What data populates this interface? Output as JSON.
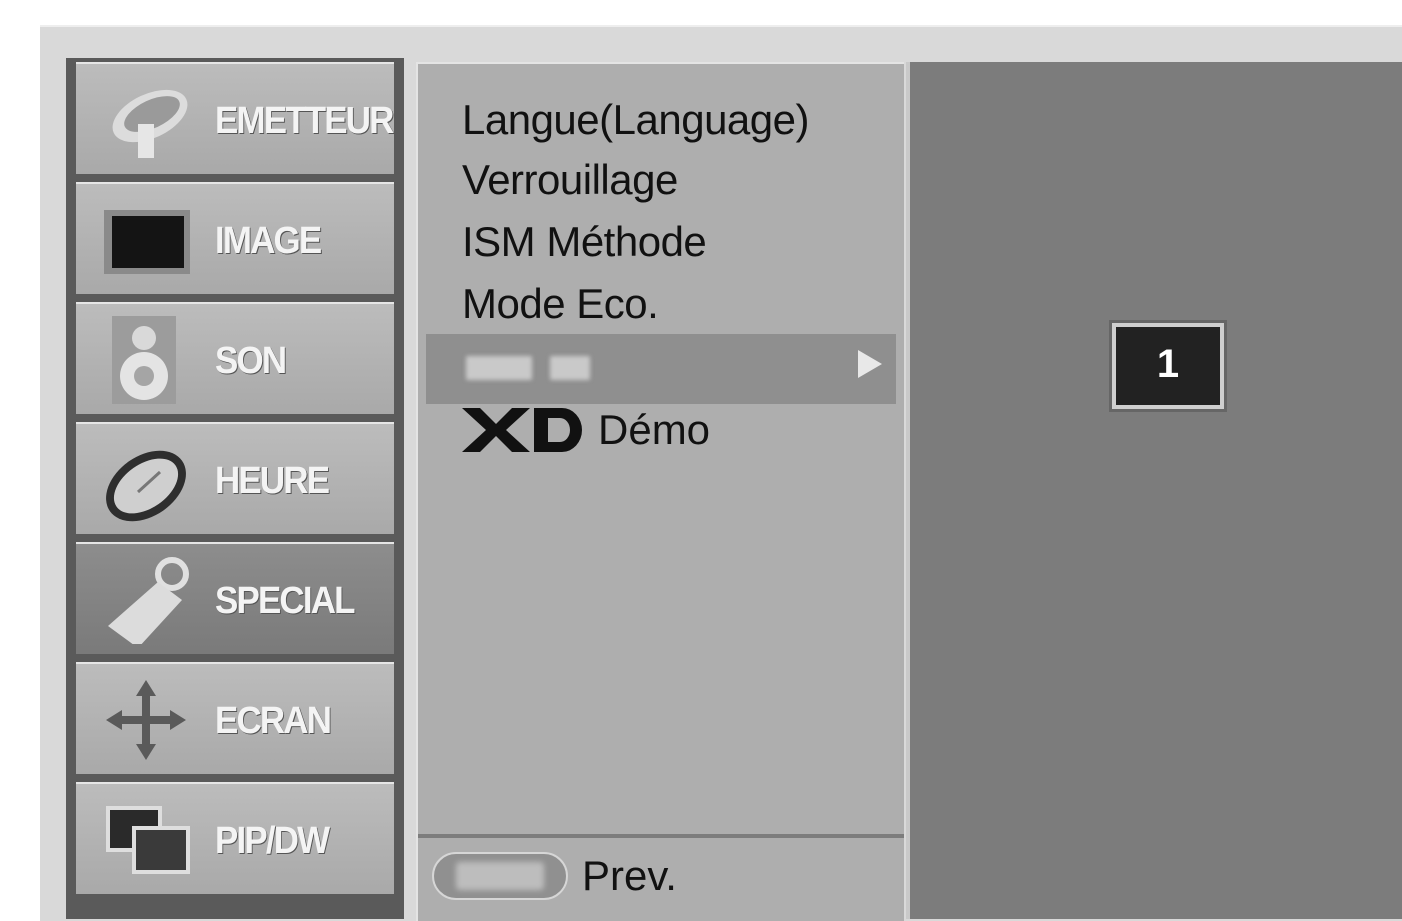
{
  "sidebar": {
    "items": [
      {
        "label": "EMETTEUR",
        "icon": "satellite-dish-icon"
      },
      {
        "label": "IMAGE",
        "icon": "tv-screen-icon"
      },
      {
        "label": "SON",
        "icon": "speaker-icon"
      },
      {
        "label": "HEURE",
        "icon": "clock-icon"
      },
      {
        "label": "SPECIAL",
        "icon": "tag-icon"
      },
      {
        "label": "ECRAN",
        "icon": "move-arrows-icon"
      },
      {
        "label": "PIP/DW",
        "icon": "pip-windows-icon"
      }
    ],
    "selected": "SPECIAL"
  },
  "menu": {
    "items": [
      {
        "label": "Langue(Language)"
      },
      {
        "label": "Verrouillage"
      },
      {
        "label": "ISM Méthode"
      },
      {
        "label": "Mode Eco."
      },
      {
        "label": "",
        "selected": true,
        "has_submenu": true
      },
      {
        "label": "Démo",
        "logo": "XD"
      }
    ],
    "footer": {
      "button_icon": "menu-button-icon",
      "prev_label": "Prev."
    }
  },
  "submenu": {
    "value": "1"
  },
  "colors": {
    "sidebar_item": "#b4b4b4",
    "sidebar_selected": "#848484",
    "menu_panel": "#aeaeae",
    "menu_selection": "#8f8f8f",
    "right_panel": "#7c7c7c",
    "value_box": "#222222"
  }
}
